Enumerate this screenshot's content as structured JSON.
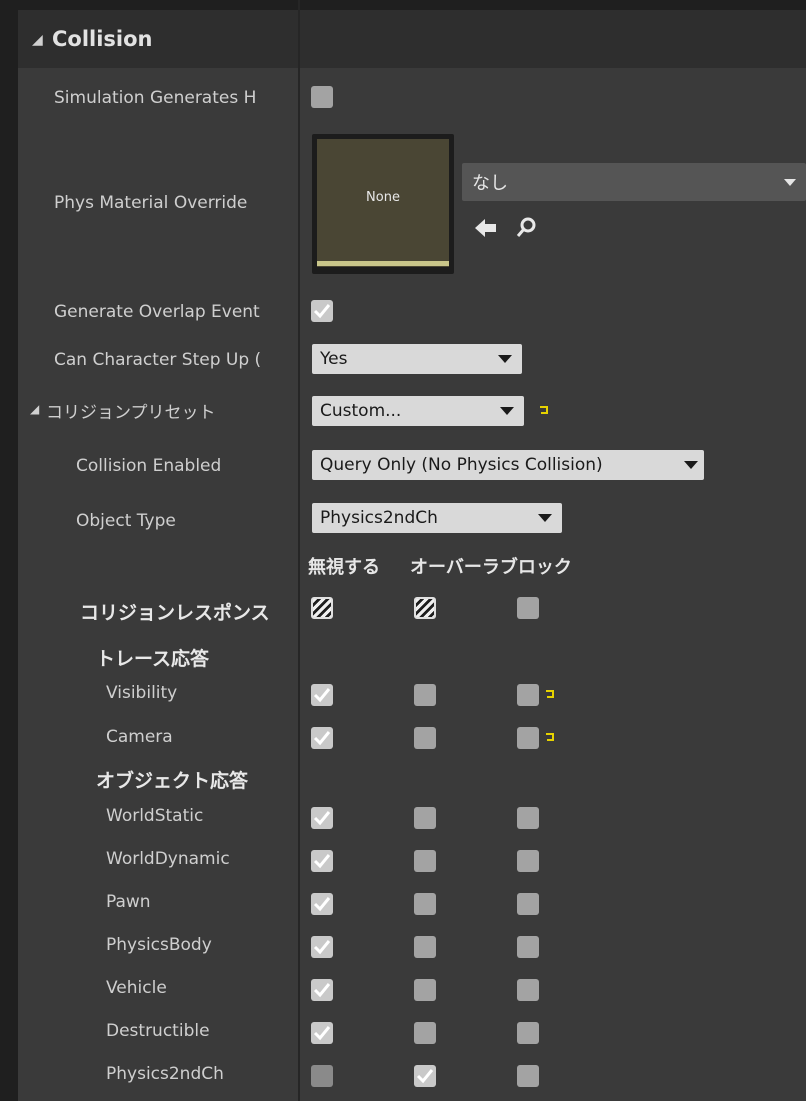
{
  "section": {
    "title": "Collision"
  },
  "properties": {
    "simulation_generates_hit": {
      "label": "Simulation Generates H",
      "checked": false
    },
    "phys_material_override": {
      "label": "Phys Material Override",
      "thumbnail_text": "None",
      "value": "なし",
      "arrow_icon": "arrow-left-icon",
      "search_icon": "search-icon"
    },
    "generate_overlap_events": {
      "label": "Generate Overlap Event",
      "checked": true
    },
    "can_character_step_up": {
      "label": "Can Character Step Up (",
      "value": "Yes"
    },
    "collision_presets": {
      "label": "コリジョンプリセット",
      "value": "Custom..."
    },
    "collision_enabled": {
      "label": "Collision Enabled",
      "value": "Query Only (No Physics Collision)"
    },
    "object_type": {
      "label": "Object Type",
      "value": "Physics2ndCh"
    }
  },
  "response_columns": {
    "ignore": "無視する",
    "overlap_block": "オーバーラブロック"
  },
  "collision_responses": {
    "label": "コリジョンレスポンス"
  },
  "trace_responses": {
    "label": "トレース応答",
    "rows": [
      {
        "name": "Visibility",
        "state": "ignore",
        "modified": true
      },
      {
        "name": "Camera",
        "state": "ignore",
        "modified": true
      }
    ]
  },
  "object_responses": {
    "label": "オブジェクト応答",
    "rows": [
      {
        "name": "WorldStatic",
        "state": "ignore"
      },
      {
        "name": "WorldDynamic",
        "state": "ignore"
      },
      {
        "name": "Pawn",
        "state": "ignore"
      },
      {
        "name": "PhysicsBody",
        "state": "ignore"
      },
      {
        "name": "Vehicle",
        "state": "ignore"
      },
      {
        "name": "Destructible",
        "state": "ignore"
      },
      {
        "name": "Physics2ndCh",
        "state": "overlap"
      }
    ]
  },
  "colors": {
    "panel": "#3a3a3a",
    "header": "#2e2e2e",
    "reset_arrow": "#e6d200"
  }
}
